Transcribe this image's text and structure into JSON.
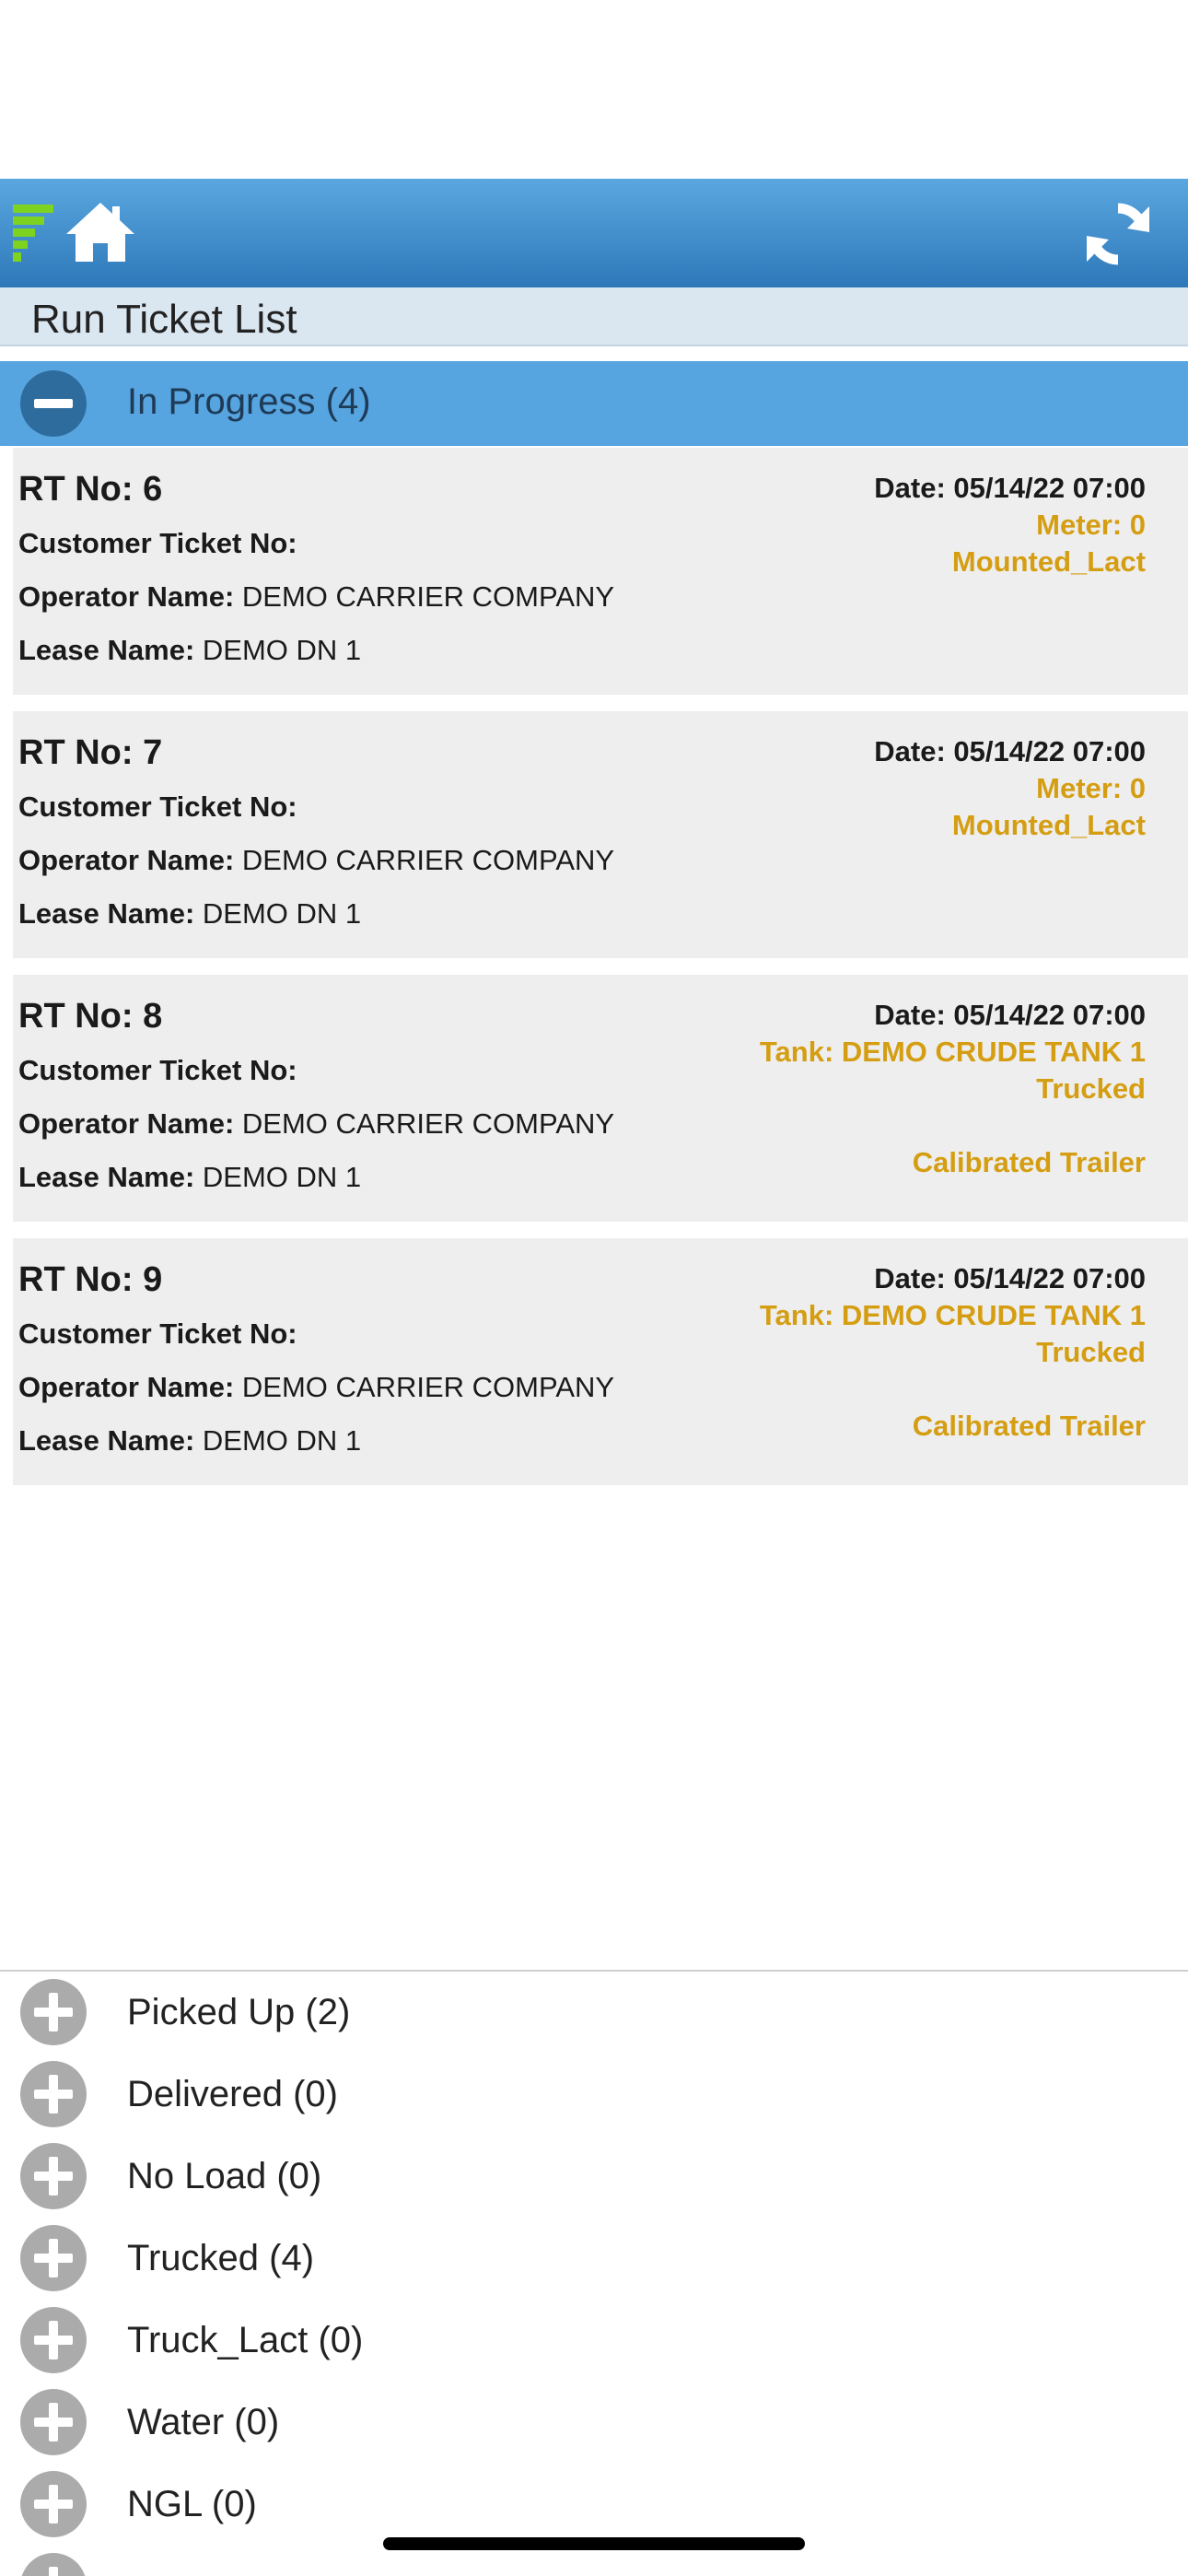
{
  "header": {
    "logo": "app-logo-icon",
    "home": "home-icon",
    "refresh": "refresh-icon",
    "colors": {
      "bar": "#3a8ad0",
      "accent": "#d59e12",
      "logo": "#7ed321"
    }
  },
  "page_title": "Run Ticket List",
  "open_group": {
    "label": "In Progress (4)"
  },
  "labels": {
    "customer_ticket": "Customer Ticket No:",
    "operator": "Operator Name:",
    "lease": "Lease Name:"
  },
  "tickets": [
    {
      "rt": "RT No: 6",
      "operator": "DEMO CARRIER COMPANY",
      "lease": "DEMO DN 1",
      "date": "Date: 05/14/22 07:00",
      "line1": "Meter: 0",
      "line2": "Mounted_Lact"
    },
    {
      "rt": "RT No: 7",
      "operator": "DEMO CARRIER COMPANY",
      "lease": "DEMO DN 1",
      "date": "Date: 05/14/22 07:00",
      "line1": "Meter: 0",
      "line2": "Mounted_Lact"
    },
    {
      "rt": "RT No: 8",
      "operator": "DEMO CARRIER COMPANY",
      "lease": "DEMO DN 1",
      "date": "Date: 05/14/22 07:00",
      "line1": "Tank: DEMO CRUDE TANK 1",
      "line2": "Trucked",
      "line3": "Calibrated Trailer"
    },
    {
      "rt": "RT No: 9",
      "operator": "DEMO CARRIER COMPANY",
      "lease": "DEMO DN 1",
      "date": "Date: 05/14/22 07:00",
      "line1": "Tank: DEMO CRUDE TANK 1",
      "line2": "Trucked",
      "line3": "Calibrated Trailer"
    }
  ],
  "groups": [
    {
      "label": "Picked Up (2)"
    },
    {
      "label": "Delivered (0)"
    },
    {
      "label": "No Load (0)"
    },
    {
      "label": "Trucked (4)"
    },
    {
      "label": "Truck_Lact (0)"
    },
    {
      "label": "Water (0)"
    },
    {
      "label": "NGL (0)"
    }
  ]
}
